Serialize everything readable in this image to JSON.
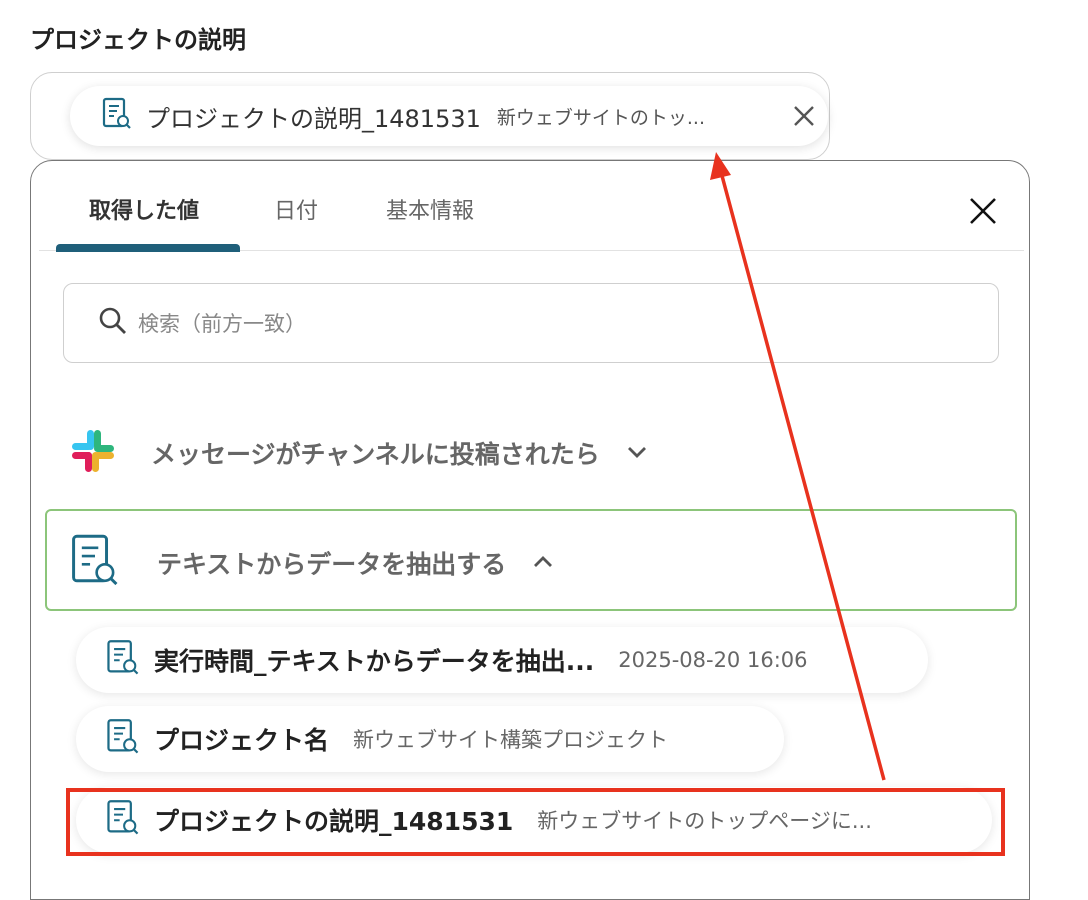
{
  "field": {
    "label": "プロジェクトの説明",
    "chip": {
      "label": "プロジェクトの説明_1481531",
      "value": "新ウェブサイトのトッ..."
    }
  },
  "popup": {
    "tabs": [
      {
        "label": "取得した値",
        "active": true
      },
      {
        "label": "日付",
        "active": false
      },
      {
        "label": "基本情報",
        "active": false
      }
    ],
    "search": {
      "placeholder": "検索（前方一致）"
    },
    "sections": [
      {
        "title": "メッセージがチャンネルに投稿されたら",
        "icon": "slack-icon",
        "expanded": false
      },
      {
        "title": "テキストからデータを抽出する",
        "icon": "document-search-icon",
        "expanded": true
      }
    ],
    "items": [
      {
        "label": "実行時間_テキストからデータを抽出...",
        "value": "2025-08-20 16:06"
      },
      {
        "label": "プロジェクト名",
        "value": "新ウェブサイト構築プロジェクト"
      },
      {
        "label": "プロジェクトの説明_1481531",
        "value": "新ウェブサイトのトップページに..."
      }
    ]
  },
  "colors": {
    "accent_tab": "#1f5f7a",
    "icon_teal": "#1d6b86",
    "group_border": "#8cc57a",
    "annotation_red": "#e8321e"
  }
}
